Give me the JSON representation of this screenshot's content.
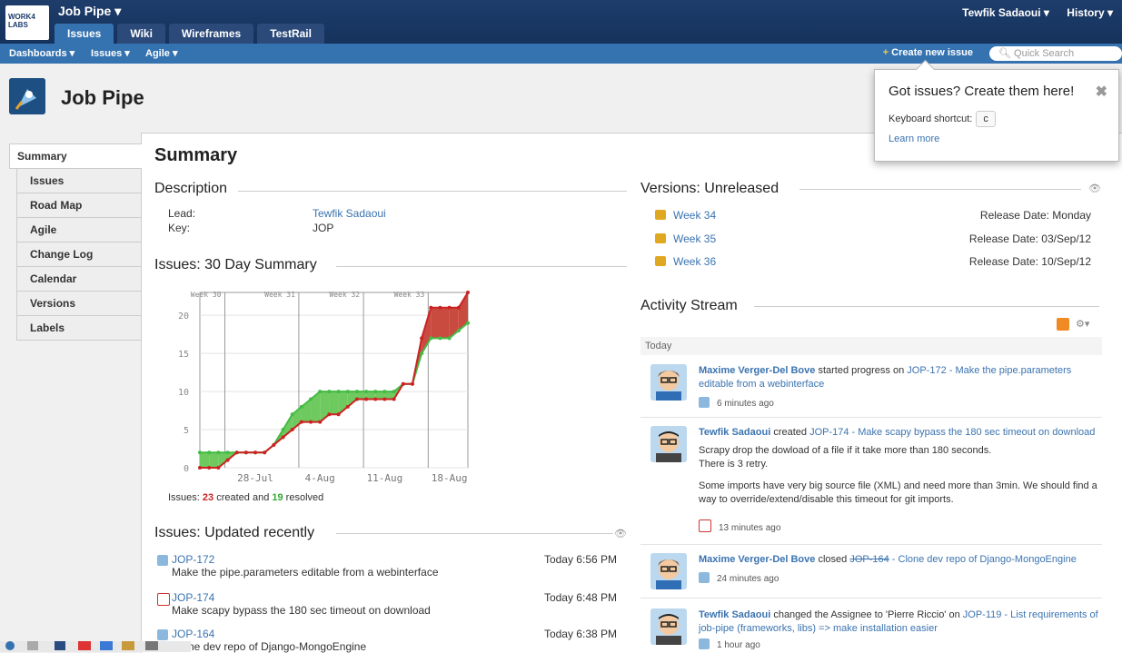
{
  "top": {
    "logo_text": "WORK4 LABS",
    "app_title": "Job Pipe ▾",
    "tabs": [
      "Issues",
      "Wiki",
      "Wireframes",
      "TestRail"
    ],
    "user": "Tewfik Sadaoui ▾",
    "history": "History ▾"
  },
  "nav": {
    "items": [
      "Dashboards ▾",
      "Issues ▾",
      "Agile ▾"
    ],
    "create_issue": "Create new issue",
    "search_placeholder": "Quick Search"
  },
  "project": {
    "title": "Job Pipe"
  },
  "sidebar": {
    "items": [
      "Summary",
      "Issues",
      "Road Map",
      "Agile",
      "Change Log",
      "Calendar",
      "Versions",
      "Labels"
    ]
  },
  "summary": {
    "heading": "Summary",
    "description_heading": "Description",
    "lead_label": "Lead:",
    "lead_value": "Tewfik Sadaoui",
    "key_label": "Key:",
    "key_value": "JOP",
    "issues30_heading": "Issues: 30 Day Summary",
    "issues_prefix": "Issues: ",
    "created_count": "23",
    "created_text": " created and ",
    "resolved_count": "19",
    "resolved_text": " resolved",
    "updated_heading": "Issues: Updated recently"
  },
  "chart_data": {
    "type": "area",
    "title": "Issues: 30 Day Summary",
    "x_ticks": [
      "28-Jul",
      "4-Aug",
      "11-Aug",
      "18-Aug"
    ],
    "week_labels": [
      "Week 30",
      "Week 31",
      "Week 32",
      "Week 33"
    ],
    "y_ticks": [
      0,
      5,
      10,
      15,
      20
    ],
    "ylim": [
      0,
      23
    ],
    "grid": true,
    "series": [
      {
        "name": "created",
        "color": "#cc2222",
        "values": [
          0,
          0,
          0,
          1,
          2,
          2,
          2,
          2,
          3,
          4,
          5,
          6,
          6,
          6,
          7,
          7,
          8,
          9,
          9,
          9,
          9,
          9,
          11,
          11,
          17,
          21,
          21,
          21,
          21,
          23
        ]
      },
      {
        "name": "resolved",
        "color": "#44bb44",
        "values": [
          2,
          2,
          2,
          2,
          2,
          2,
          2,
          2,
          3,
          5,
          7,
          8,
          9,
          10,
          10,
          10,
          10,
          10,
          10,
          10,
          10,
          10,
          11,
          11,
          15,
          17,
          17,
          17,
          18,
          19
        ]
      }
    ]
  },
  "updated": [
    {
      "key": "JOP-172",
      "summary": "Make the pipe.parameters editable from a webinterface",
      "date": "Today 6:56 PM",
      "icon": "task-icon"
    },
    {
      "key": "JOP-174",
      "summary": "Make scapy bypass the 180 sec timeout on download",
      "date": "Today 6:48 PM",
      "icon": "bug-icon"
    },
    {
      "key": "JOP-164",
      "summary": "Clone dev repo of Django-MongoEngine",
      "date": "Today 6:38 PM",
      "icon": "task-icon"
    }
  ],
  "versions": {
    "heading": "Versions: Unreleased",
    "items": [
      {
        "name": "Week 34",
        "date": "Release Date: Monday"
      },
      {
        "name": "Week 35",
        "date": "Release Date: 03/Sep/12"
      },
      {
        "name": "Week 36",
        "date": "Release Date: 10/Sep/12"
      }
    ]
  },
  "activity": {
    "heading": "Activity Stream",
    "today": "Today",
    "items": [
      {
        "user": "Maxime Verger-Del Bove",
        "verb": " started progress on ",
        "target": "JOP-172 - Make the pipe.parameters editable from a webinterface",
        "time": "6 minutes ago"
      },
      {
        "user": "Tewfik Sadaoui",
        "verb": " created ",
        "target": "JOP-174 - Make scapy bypass the 180 sec timeout on download",
        "body1": "Scrapy drop the dowload of a file if it take more than 180 seconds.",
        "body2": "There is 3 retry.",
        "body3": "Some imports have very big source file (XML) and need more than 3min. We should find a way to override/extend/disable this timeout for git imports.",
        "time": "13 minutes ago"
      },
      {
        "user": "Maxime Verger-Del Bove",
        "verb": " closed ",
        "target_struck": "JOP-164",
        "target": " - Clone dev repo of Django-MongoEngine",
        "time": "24 minutes ago"
      },
      {
        "user": "Tewfik Sadaoui",
        "verb": " changed the Assignee to 'Pierre Riccio' on ",
        "target": "JOP-119 - List requirements of job-pipe (frameworks, libs) => make installation easier",
        "time": "1 hour ago"
      }
    ]
  },
  "popup": {
    "title": "Got issues? Create them here!",
    "close": "✖",
    "shortcut_label": "Keyboard shortcut:",
    "shortcut_key": "c",
    "learn_more": "Learn more"
  }
}
